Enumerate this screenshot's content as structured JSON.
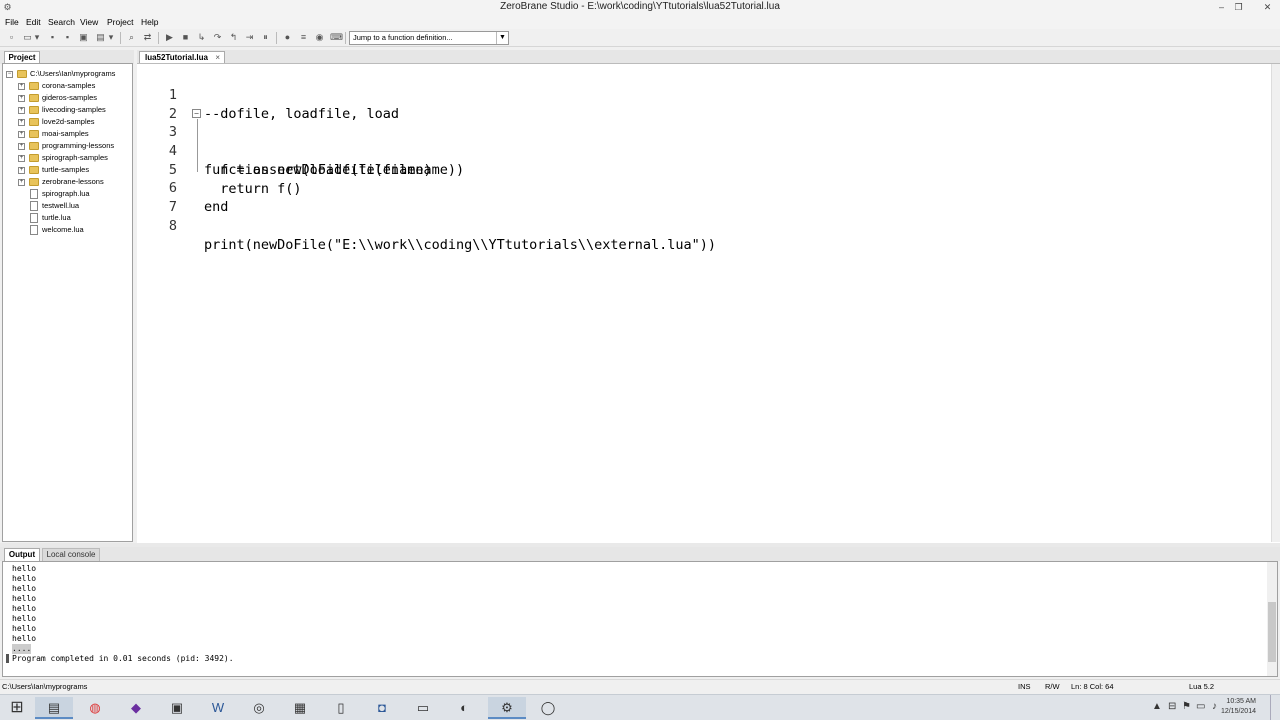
{
  "window": {
    "title": "ZeroBrane Studio - E:\\work\\coding\\YTtutorials\\lua52Tutorial.lua",
    "minimize": "–",
    "restore": "❐",
    "close": "✕"
  },
  "menu": [
    "File",
    "Edit",
    "Search",
    "View",
    "Project",
    "Help"
  ],
  "toolbar": {
    "function_jump_placeholder": "Jump to a function definition..."
  },
  "project": {
    "tab_label": "Project",
    "root": "C:\\Users\\Ian\\myprograms",
    "items": [
      {
        "label": "corona-samples",
        "type": "folder"
      },
      {
        "label": "gideros-samples",
        "type": "folder"
      },
      {
        "label": "livecoding-samples",
        "type": "folder"
      },
      {
        "label": "love2d-samples",
        "type": "folder"
      },
      {
        "label": "moai-samples",
        "type": "folder"
      },
      {
        "label": "programming-lessons",
        "type": "folder"
      },
      {
        "label": "spirograph-samples",
        "type": "folder"
      },
      {
        "label": "turtle-samples",
        "type": "folder"
      },
      {
        "label": "zerobrane-lessons",
        "type": "folder"
      },
      {
        "label": "spirograph.lua",
        "type": "file"
      },
      {
        "label": "testwell.lua",
        "type": "file"
      },
      {
        "label": "turtle.lua",
        "type": "file"
      },
      {
        "label": "welcome.lua",
        "type": "file"
      }
    ]
  },
  "editor": {
    "tab_label": "lua52Tutorial.lua",
    "tab_close": "×",
    "lines": [
      {
        "num": "1",
        "text": "--dofile, loadfile, load"
      },
      {
        "num": "2",
        "text": ""
      },
      {
        "num": "3",
        "text": "function newDoFile(filename)"
      },
      {
        "num": "4",
        "text": "  f = assert(loadfile(filename))"
      },
      {
        "num": "5",
        "text": "  return f()"
      },
      {
        "num": "6",
        "text": "end"
      },
      {
        "num": "7",
        "text": ""
      },
      {
        "num": "8",
        "text": "print(newDoFile(\"E:\\\\work\\\\coding\\\\YTtutorials\\\\external.lua\"))"
      }
    ]
  },
  "output": {
    "tab_label": "Output",
    "console_tab_label": "Local console",
    "lines": [
      "hello",
      "hello",
      "hello",
      "hello",
      "hello",
      "hello",
      "hello",
      "hello"
    ],
    "last_fragment": "....",
    "status_line": "Program completed in 0.01 seconds (pid: 3492)."
  },
  "statusbar": {
    "path": "C:\\Users\\Ian\\myprograms",
    "mode": "INS",
    "access": "R/W",
    "position": "Ln: 8 Col: 64",
    "interpreter": "Lua 5.2"
  },
  "taskbar": {
    "time": "10:35 AM",
    "date": "12/15/2014"
  },
  "colors": {
    "folder": "#e8c35a",
    "accent": "#5b8bc4"
  }
}
